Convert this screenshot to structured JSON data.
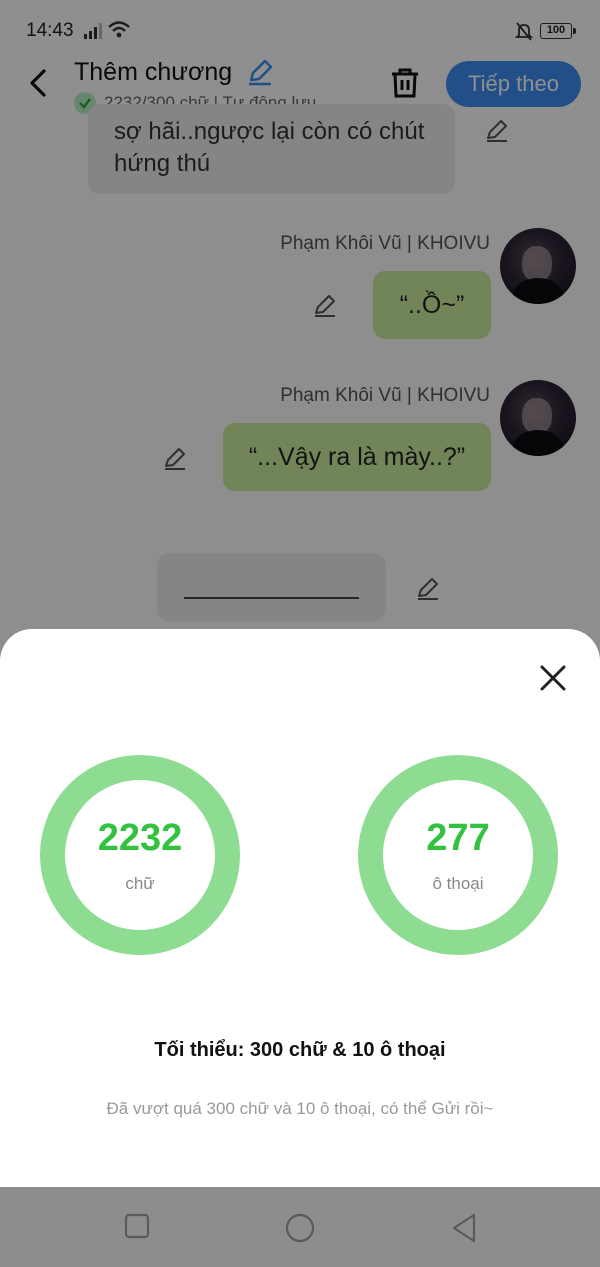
{
  "status_bar": {
    "time": "14:43",
    "battery": "100"
  },
  "header": {
    "title": "Thêm chương",
    "word_count_status": "2232/300 chữ | Tự động lưu",
    "next_label": "Tiếp theo"
  },
  "chat": {
    "previous_bubble": "sợ hãi..ngược lại còn có chút hứng thú",
    "messages": [
      {
        "author": "Phạm Khôi Vũ | KHOIVU",
        "text": "“..Ồ~”"
      },
      {
        "author": "Phạm Khôi Vũ | KHOIVU",
        "text": "“...Vậy ra là mày..?”"
      }
    ]
  },
  "stats_sheet": {
    "words": {
      "value": "2232",
      "label": "chữ"
    },
    "dialogues": {
      "value": "277",
      "label": "ô thoại"
    },
    "minimum": "Tối thiểu: 300 chữ & 10 ô thoại",
    "note": "Đã vượt quá 300 chữ và 10 ô thoại, có thể Gửi rồi~"
  },
  "colors": {
    "accent_blue": "#3d8ef0",
    "ring_green": "#8ddc91",
    "count_green": "#33c23f",
    "bubble_green": "#c9ee9f"
  }
}
